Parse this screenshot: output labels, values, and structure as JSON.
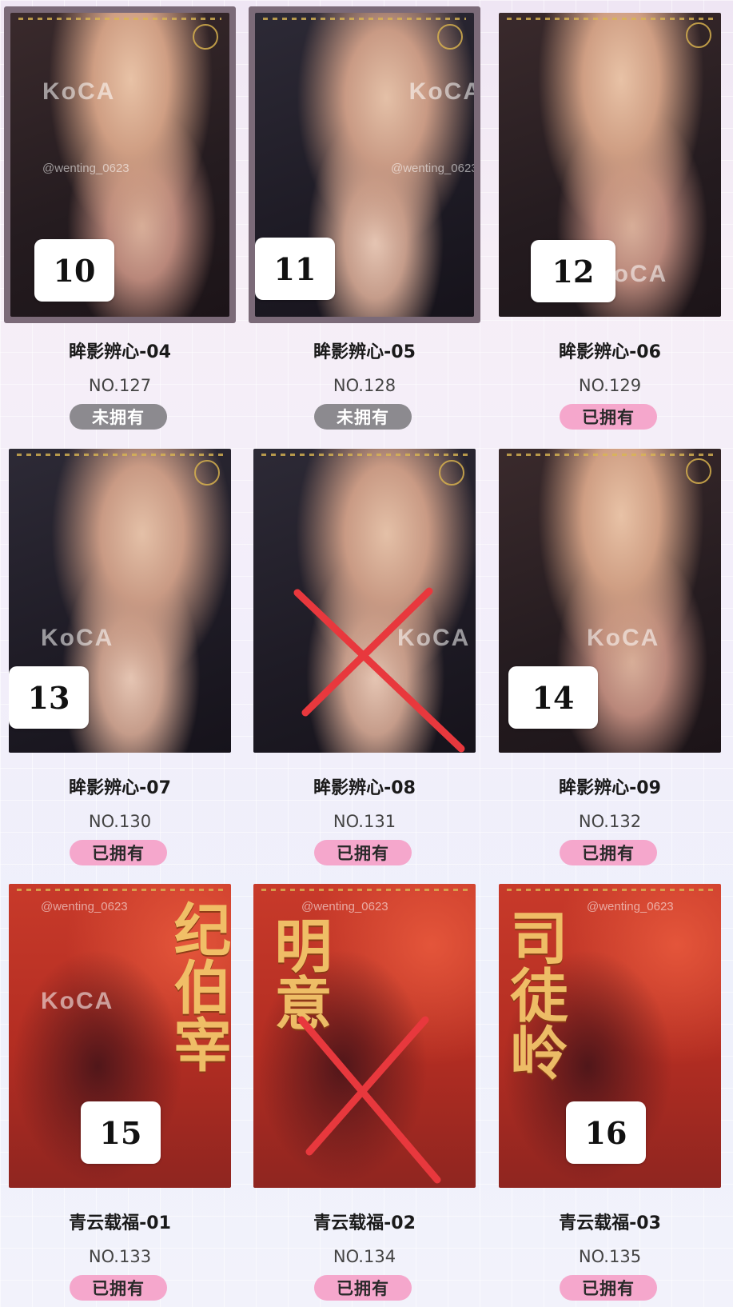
{
  "watermark": {
    "brand": "KoCA",
    "user": "@wenting_0623"
  },
  "colors": {
    "owned_badge": "#f5a7cc",
    "unowned_badge": "#8c8a8f",
    "cross_mark": "#e8383d",
    "poster_red": "#c83a2a"
  },
  "cards": [
    {
      "title": "眸影辨心-04",
      "no": "NO.127",
      "status": "未拥有",
      "owned": false,
      "badge_number": "10",
      "crossed": false
    },
    {
      "title": "眸影辨心-05",
      "no": "NO.128",
      "status": "未拥有",
      "owned": false,
      "badge_number": "11",
      "crossed": false
    },
    {
      "title": "眸影辨心-06",
      "no": "NO.129",
      "status": "已拥有",
      "owned": true,
      "badge_number": "12",
      "crossed": false
    },
    {
      "title": "眸影辨心-07",
      "no": "NO.130",
      "status": "已拥有",
      "owned": true,
      "badge_number": "13",
      "crossed": false
    },
    {
      "title": "眸影辨心-08",
      "no": "NO.131",
      "status": "已拥有",
      "owned": true,
      "badge_number": "",
      "crossed": true
    },
    {
      "title": "眸影辨心-09",
      "no": "NO.132",
      "status": "已拥有",
      "owned": true,
      "badge_number": "14",
      "crossed": false
    },
    {
      "title": "青云载福-01",
      "no": "NO.133",
      "status": "已拥有",
      "owned": true,
      "badge_number": "15",
      "crossed": false,
      "poster_text": "纪伯宰"
    },
    {
      "title": "青云载福-02",
      "no": "NO.134",
      "status": "已拥有",
      "owned": true,
      "badge_number": "",
      "crossed": true,
      "poster_text": "明意"
    },
    {
      "title": "青云载福-03",
      "no": "NO.135",
      "status": "已拥有",
      "owned": true,
      "badge_number": "16",
      "crossed": false,
      "poster_text": "司徒岭"
    }
  ]
}
